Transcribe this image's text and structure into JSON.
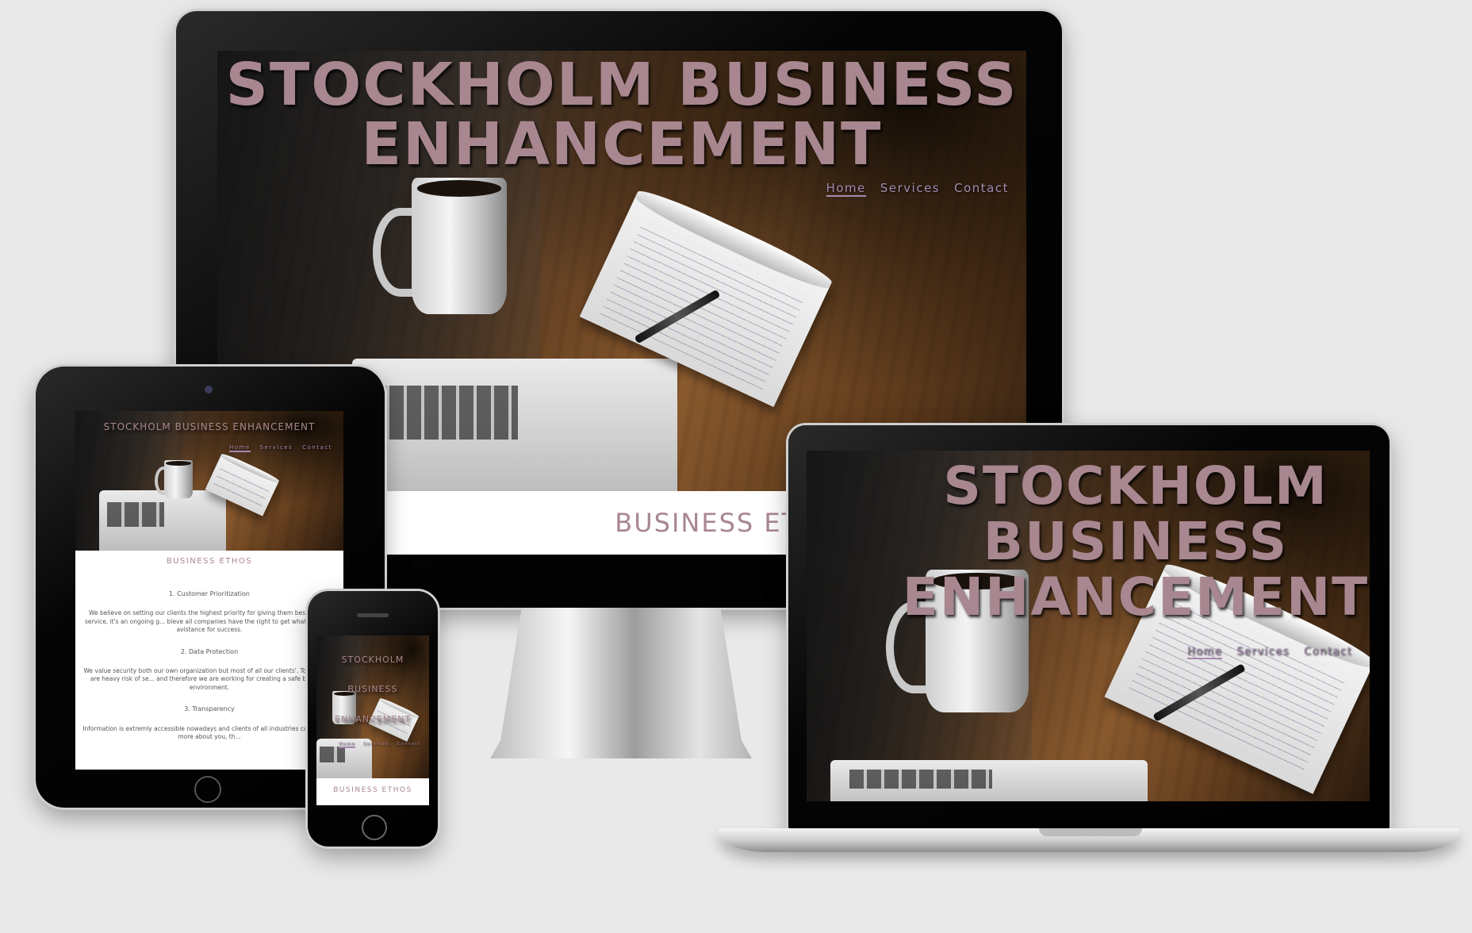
{
  "site": {
    "title": "STOCKHOLM BUSINESS ENHANCEMENT",
    "title_two_lines": "STOCKHOLM BUSINESS\nENHANCEMENT",
    "title_three_lines": "STOCKHOLM\nBUSINESS\nENHANCEMENT",
    "nav": [
      "Home",
      "Services",
      "Contact"
    ],
    "active_nav": "Home",
    "section_heading": "BUSINESS ETHOS"
  },
  "ethos": [
    {
      "heading": "1. Customer Prioritization",
      "body": "We believe on setting our clients the highest priority for giving them best quality service, it's an ongoing g... bleve all companies have the right to get what the right avistance for success."
    },
    {
      "heading": "2. Data Protection",
      "body": "We value security both our own organization but most of all our clients'. Today there are heavy risk of se... and therefore we are working for creating a safe business environment."
    },
    {
      "heading": "3. Transparency",
      "body": "Information is extremly accessible nowadays and clients of all industries can find out more about you, th..."
    }
  ],
  "colors": {
    "title": "#a88790",
    "nav": "#a88bb0",
    "background": "#e9e9e9"
  }
}
